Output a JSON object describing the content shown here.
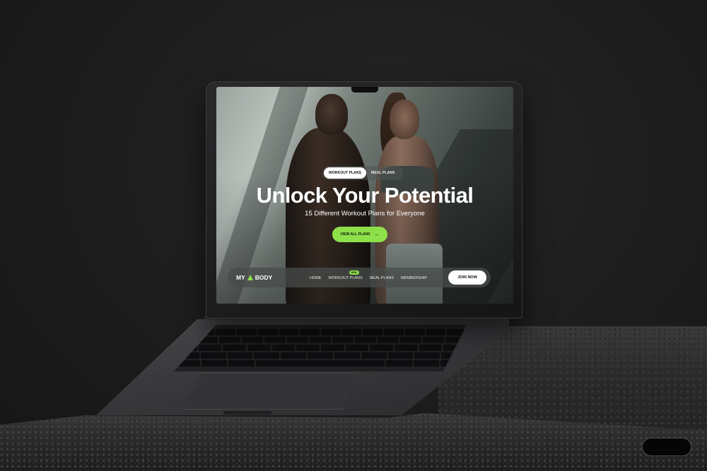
{
  "hero": {
    "tabs": [
      {
        "label": "WORKOUT PLANS",
        "active": true
      },
      {
        "label": "MEAL PLANS",
        "active": false
      }
    ],
    "title": "Unlock Your Potential",
    "subtitle": "15 Different Workout Plans for Everyone",
    "cta_label": "VIEW ALL PLANS",
    "cta_icon": "arrow-right-icon"
  },
  "nav": {
    "logo_left": "MY",
    "logo_right": "BODY",
    "links": [
      "HOME",
      "WORKOUT PLANS",
      "MEAL PLANS",
      "MEMBERSHIP"
    ],
    "new_badge": "NEW",
    "join_label": "JOIN NOW"
  },
  "colors": {
    "accent_green": "#8ee04a",
    "background": "#1b1b1b",
    "nav_bg": "#484c4b",
    "white": "#ffffff"
  }
}
